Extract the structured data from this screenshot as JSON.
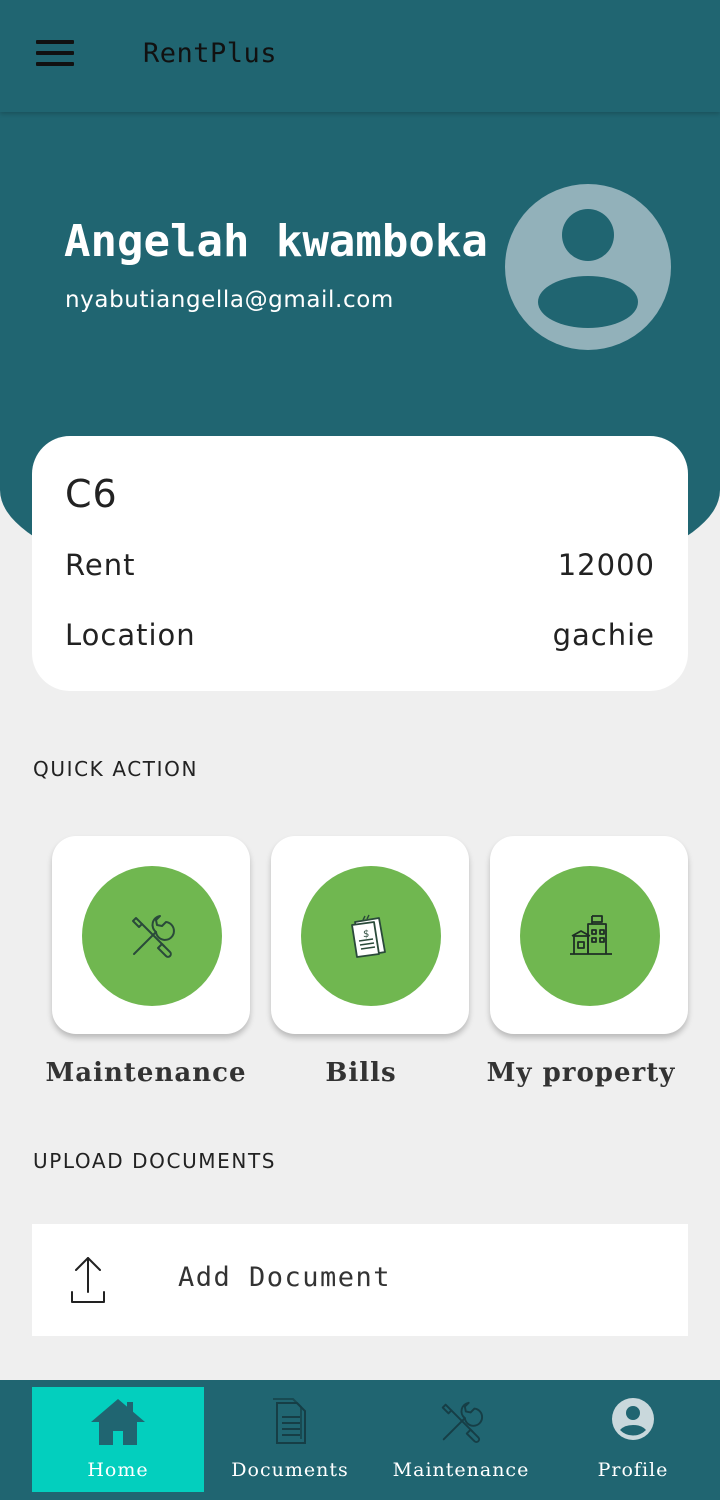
{
  "app": {
    "title": "RentPlus"
  },
  "user": {
    "name": "Angelah kwamboka",
    "email": "nyabutiangella@gmail.com"
  },
  "unit": {
    "code": "C6",
    "rows": [
      {
        "label": "Rent",
        "value": "12000"
      },
      {
        "label": "Location",
        "value": "gachie"
      }
    ]
  },
  "quick_action": {
    "title": "QUICK ACTION",
    "items": [
      {
        "label": "Maintenance",
        "icon": "tools-icon"
      },
      {
        "label": "Bills",
        "icon": "bill-icon"
      },
      {
        "label": "My property",
        "icon": "building-icon"
      }
    ]
  },
  "upload": {
    "title": "UPLOAD DOCUMENTS",
    "add_label": "Add Document",
    "icon": "upload-icon"
  },
  "nav": {
    "items": [
      {
        "label": "Home",
        "icon": "home-icon",
        "active": true
      },
      {
        "label": "Documents",
        "icon": "document-icon",
        "active": false
      },
      {
        "label": "Maintenance",
        "icon": "tools-icon",
        "active": false
      },
      {
        "label": "Profile",
        "icon": "account-circle-icon",
        "active": false
      }
    ]
  },
  "colors": {
    "primary": "#206571",
    "accent_green": "#70b750",
    "nav_active": "#03cfbe",
    "avatar_bg": "#92b1ba",
    "background": "#efefef"
  }
}
